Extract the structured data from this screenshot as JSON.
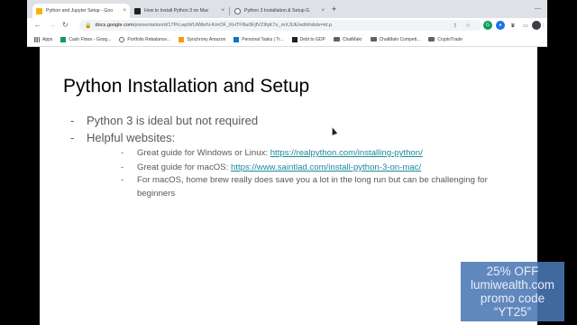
{
  "browser": {
    "tabs": [
      {
        "label": "Python and Jupyter Setup - Goo",
        "favicon_color": "#f4b400",
        "active": true
      },
      {
        "label": "How to Install Python 3 on Mac",
        "favicon_color": "#202124",
        "active": false
      },
      {
        "label": "Python 3 Installation & Setup G",
        "favicon_color": "#5f6368",
        "active": false
      }
    ],
    "new_tab_label": "+",
    "url_host": "docs.google.com",
    "url_path": "/presentation/d/17PrLwpWUiWkrN-KmOF_KHTF8w3FjfVZIfqK7o_mXJUE/edit#slide=id.p",
    "bookmarks": [
      {
        "label": "Apps",
        "icon": "apps-grid-icon",
        "icon_color": "#5f6368"
      },
      {
        "label": "Cash Flows - Goog...",
        "icon": "sheet-icon",
        "icon_color": "#0f9d58"
      },
      {
        "label": "Portfolio Rebalance...",
        "icon": "gear-icon",
        "icon_color": "#5f6368"
      },
      {
        "label": "Synchrony Amazon",
        "icon": "amazon-icon",
        "icon_color": "#ff9900"
      },
      {
        "label": "Personal Tasks | Tr...",
        "icon": "trello-icon",
        "icon_color": "#0079bf"
      },
      {
        "label": "Debt to GDP",
        "icon": "chart-icon",
        "icon_color": "#202124"
      },
      {
        "label": "ChatMakr",
        "icon": "folder-icon",
        "icon_color": "#5f6368"
      },
      {
        "label": "ChatMakr Competi...",
        "icon": "folder-icon",
        "icon_color": "#5f6368"
      },
      {
        "label": "CryptoTrade",
        "icon": "folder-icon",
        "icon_color": "#5f6368"
      }
    ]
  },
  "slide": {
    "title": "Python Installation and Setup",
    "bullets": [
      {
        "text": "Python 3 is ideal but not required"
      },
      {
        "text": "Helpful websites:"
      }
    ],
    "sub_bullets": [
      {
        "prefix": "Great guide for Windows or Linux: ",
        "link": "https://realpython.com/installing-python/"
      },
      {
        "prefix": "Great guide for macOS: ",
        "link": "https://www.saintlad.com/install-python-3-on-mac/"
      },
      {
        "prefix": "For macOS, home brew really does save you a lot in the long run but can be challenging for beginners",
        "link": ""
      }
    ],
    "dash": "-",
    "link_color": "#1a8a9c"
  },
  "promo": {
    "line1": "25% OFF",
    "line2": "lumiwealth.com",
    "line3": "promo code",
    "line4": "“YT25”"
  }
}
